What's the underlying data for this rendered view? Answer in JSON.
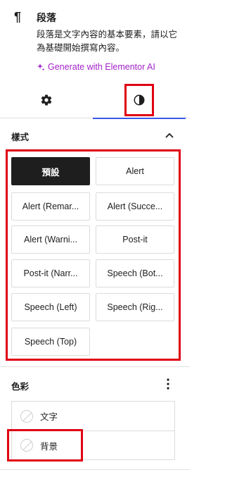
{
  "block": {
    "icon": "pilcrow-icon",
    "title": "段落",
    "description": "段落是文字內容的基本要素，請以它為基礎開始撰寫內容。",
    "ai_link": "Generate with Elementor AI",
    "ai_color": "#a323c9"
  },
  "tabs": [
    {
      "icon": "gear-icon",
      "active": false
    },
    {
      "icon": "half-circle-contrast-icon",
      "active": true
    }
  ],
  "styles": {
    "title": "樣式",
    "buttons": [
      {
        "label": "預設",
        "active": true
      },
      {
        "label": "Alert"
      },
      {
        "label": "Alert (Remar..."
      },
      {
        "label": "Alert (Succe..."
      },
      {
        "label": "Alert (Warni..."
      },
      {
        "label": "Post-it"
      },
      {
        "label": "Post-it (Narr..."
      },
      {
        "label": "Speech (Bot..."
      },
      {
        "label": "Speech (Left)"
      },
      {
        "label": "Speech (Rig..."
      },
      {
        "label": "Speech (Top)"
      }
    ]
  },
  "color": {
    "title": "色彩",
    "items": [
      {
        "label": "文字"
      },
      {
        "label": "背景"
      }
    ]
  },
  "colors": {
    "accent": "#3858e9",
    "highlight_box": "#e00012"
  }
}
